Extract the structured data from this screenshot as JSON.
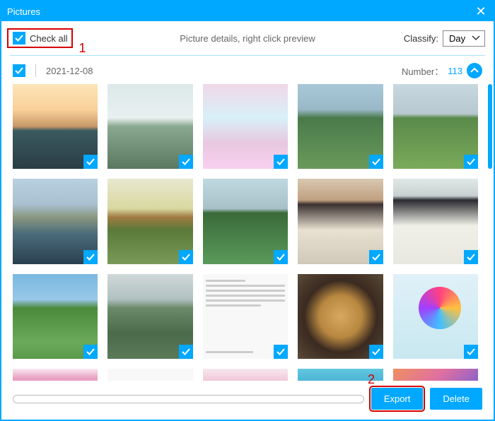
{
  "window": {
    "title": "Pictures"
  },
  "header": {
    "check_all_label": "Check all",
    "hint": "Picture details, right click preview",
    "classify_label": "Classify:",
    "classify_value": "Day"
  },
  "group": {
    "date": "2021-12-08",
    "number_label": "Number：",
    "number_value": "113"
  },
  "footer": {
    "export_label": "Export",
    "delete_label": "Delete"
  },
  "annotations": {
    "one": "1",
    "two": "2"
  }
}
